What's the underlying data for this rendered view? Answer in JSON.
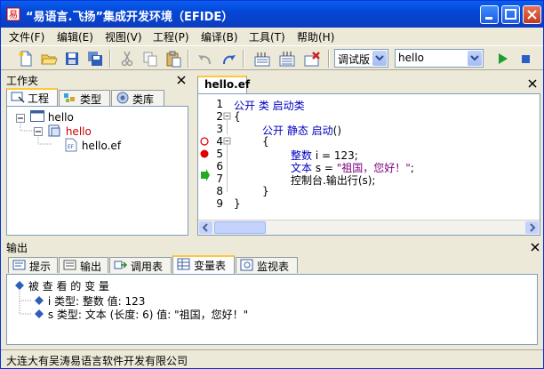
{
  "window": {
    "title": "“易语言.飞扬”集成开发环境（EFIDE）"
  },
  "menu": [
    {
      "label": "文件(F)"
    },
    {
      "label": "编辑(E)"
    },
    {
      "label": "视图(V)"
    },
    {
      "label": "工程(P)"
    },
    {
      "label": "编译(B)"
    },
    {
      "label": "工具(T)"
    },
    {
      "label": "帮助(H)"
    }
  ],
  "toolbar": {
    "build_mode": "调试版",
    "project_select": "hello"
  },
  "workspace": {
    "title": "工作夹",
    "tabs": [
      {
        "label": "工程"
      },
      {
        "label": "类型"
      },
      {
        "label": "类库"
      }
    ],
    "tree": {
      "root": "hello",
      "project": "hello",
      "file": "hello.ef"
    }
  },
  "editor": {
    "tab": "hello.ef",
    "lines": [
      {
        "no": "1"
      },
      {
        "no": "2"
      },
      {
        "no": "3"
      },
      {
        "no": "4"
      },
      {
        "no": "5"
      },
      {
        "no": "6"
      },
      {
        "no": "7"
      },
      {
        "no": "8"
      },
      {
        "no": "9"
      }
    ],
    "code": {
      "l1_kw": "公开 类 启动类",
      "l2": "{",
      "l3_kw": "公开 静态 启动",
      "l3_rest": "()",
      "l4": "{",
      "l5_kw": "整数",
      "l5_rest": " i = 123;",
      "l6_kw": "文本",
      "l6_rest": " s = ",
      "l6_str": "\"祖国，您好！\"",
      "l6_end": ";",
      "l7": "控制台.输出行(s);",
      "l8": "}",
      "l9": "}"
    }
  },
  "output": {
    "title": "输出",
    "tabs": [
      {
        "label": "提示"
      },
      {
        "label": "输出"
      },
      {
        "label": "调用表"
      },
      {
        "label": "变量表"
      },
      {
        "label": "监视表"
      }
    ],
    "root": "被 查 看 的 变 量",
    "var1": "i   类型: 整数  值: 123",
    "var2": "s   类型: 文本 (长度: 6)  值: \"祖国，您好！\""
  },
  "status": {
    "text": "大连大有吴涛易语言软件开发有限公司"
  },
  "colors": {
    "title_bar": "#0A4FE0",
    "keyword": "#0000C0",
    "string": "#800080",
    "tree_project": "#CC0000",
    "breakpoint": "#E00000",
    "exec_arrow": "#22AA22"
  }
}
